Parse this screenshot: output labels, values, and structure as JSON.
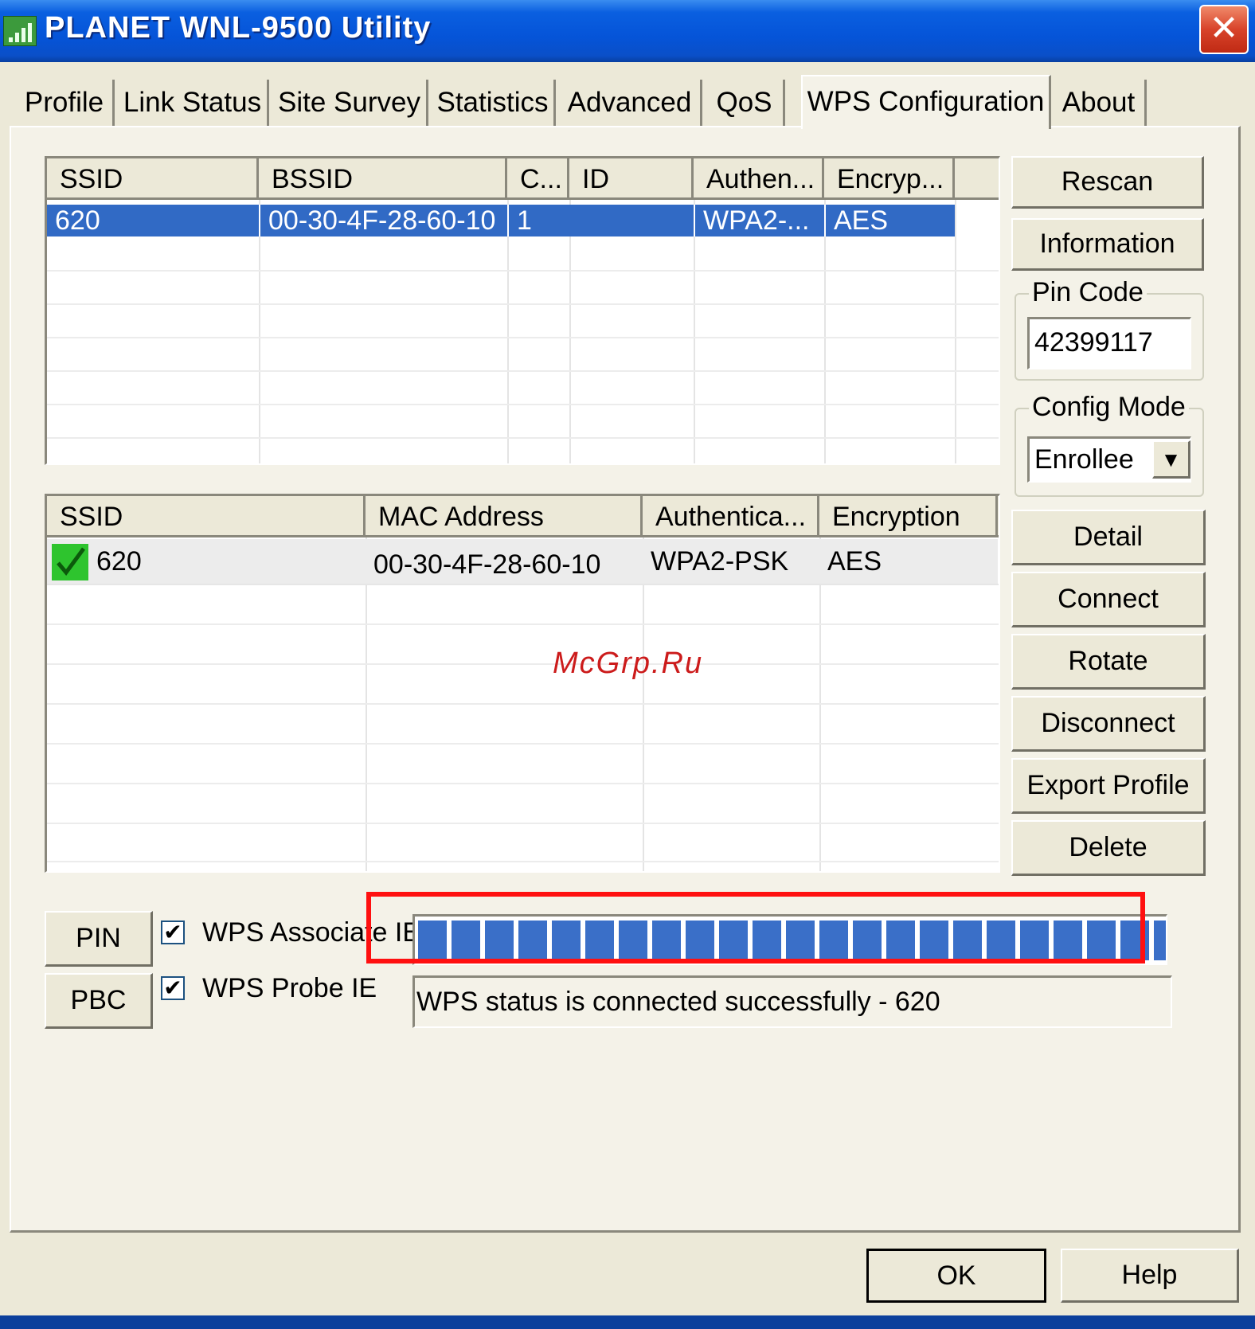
{
  "window": {
    "title": "PLANET WNL-9500 Utility",
    "close_glyph": "✕"
  },
  "tabs": [
    {
      "label": "Profile"
    },
    {
      "label": "Link Status"
    },
    {
      "label": "Site Survey"
    },
    {
      "label": "Statistics"
    },
    {
      "label": "Advanced"
    },
    {
      "label": "QoS"
    },
    {
      "label": "WPS Configuration",
      "active": true
    },
    {
      "label": "About"
    }
  ],
  "ap_list": {
    "columns": [
      "SSID",
      "BSSID",
      "C...",
      "ID",
      "Authen...",
      "Encryp..."
    ],
    "rows": [
      {
        "ssid": "620",
        "bssid": "00-30-4F-28-60-10",
        "channel": "1",
        "id": "",
        "auth": "WPA2-...",
        "enc": "AES"
      }
    ]
  },
  "profile_list": {
    "columns": [
      "SSID",
      "MAC Address",
      "Authentica...",
      "Encryption"
    ],
    "rows": [
      {
        "ssid": "620",
        "mac": "00-30-4F-28-60-10",
        "auth": "WPA2-PSK",
        "enc": "AES",
        "icon": "green-check-icon"
      }
    ]
  },
  "buttons": {
    "rescan": "Rescan",
    "information": "Information",
    "detail": "Detail",
    "connect": "Connect",
    "rotate": "Rotate",
    "disconnect": "Disconnect",
    "export_profile": "Export Profile",
    "delete": "Delete",
    "pin": "PIN",
    "pbc": "PBC",
    "ok": "OK",
    "help": "Help"
  },
  "pin_code": {
    "label": "Pin Code",
    "value": "42399117"
  },
  "config_mode": {
    "label": "Config Mode",
    "value": "Enrollee",
    "arrow": "▼"
  },
  "checkboxes": {
    "associate_ie": {
      "label": "WPS Associate IE",
      "checked": true,
      "mark": "✔"
    },
    "probe_ie": {
      "label": "WPS Probe IE",
      "checked": true,
      "mark": "✔"
    }
  },
  "progress": {
    "fraction": 1.0,
    "color": "#3a6fc8"
  },
  "status": {
    "text": "WPS status is connected successfully - 620"
  },
  "watermark": "McGrp.Ru",
  "colors": {
    "selection": "#316ac5",
    "highlight_frame": "#ff1010",
    "title_bar": "#0554d8"
  }
}
